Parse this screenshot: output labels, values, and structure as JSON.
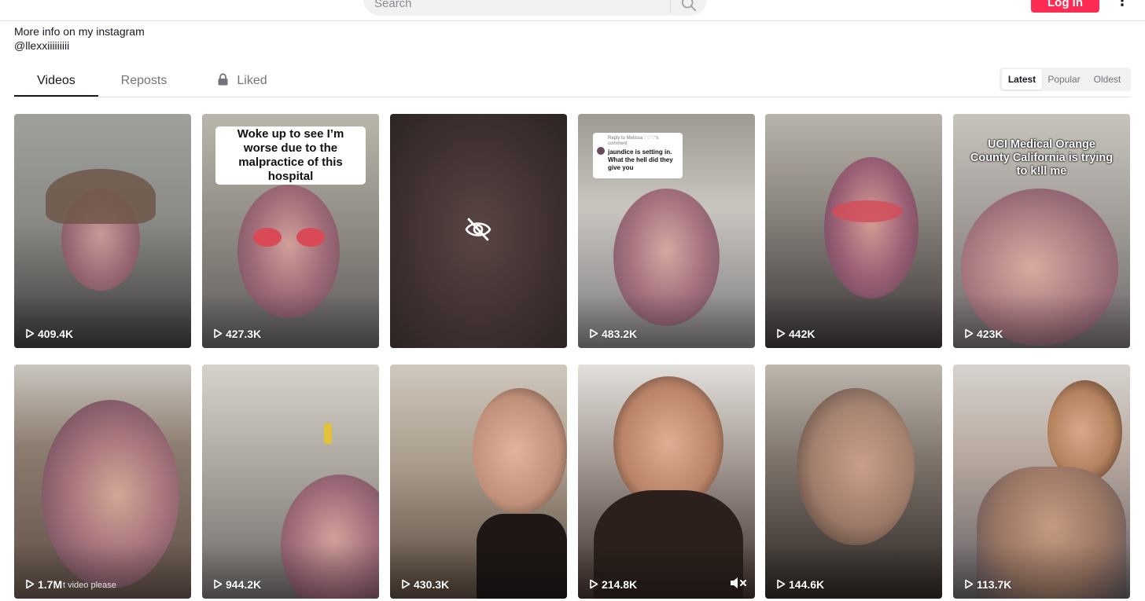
{
  "header": {
    "search_placeholder": "Search",
    "login_label": "Log in",
    "more_label": "⋮"
  },
  "bio": {
    "line1": "More info on my instagram",
    "line2": "@llexxiiiiiiiii"
  },
  "tabs": [
    {
      "label": "Videos",
      "active": true
    },
    {
      "label": "Reposts",
      "active": false
    },
    {
      "label": "Liked",
      "active": false,
      "icon": "lock-icon"
    }
  ],
  "sort": {
    "options": [
      "Latest",
      "Popular",
      "Oldest"
    ],
    "selected": "Latest"
  },
  "videos": [
    {
      "views": "409.4K"
    },
    {
      "views": "427.3K",
      "caption": "Woke up to see I’m worse due to the malpractice of this hospital"
    },
    {
      "hidden": true,
      "icon": "hidden-eye-icon"
    },
    {
      "views": "483.2K",
      "reply_header": "Reply to Melissa♡♡♡'s comment",
      "reply_text": "jaundice is setting in. What the hell did they give you"
    },
    {
      "views": "442K"
    },
    {
      "views": "423K",
      "caption": "UCI Medical Orange County California is trying to k!ll me"
    },
    {
      "views": "1.7M",
      "overlay_text": "t video please"
    },
    {
      "views": "944.2K"
    },
    {
      "views": "430.3K"
    },
    {
      "views": "214.8K",
      "icon": "muted-speaker-icon"
    },
    {
      "views": "144.6K"
    },
    {
      "views": "113.7K"
    }
  ],
  "colors": {
    "accent": "#fe2c55",
    "text": "#161823",
    "muted": "#73747b"
  }
}
